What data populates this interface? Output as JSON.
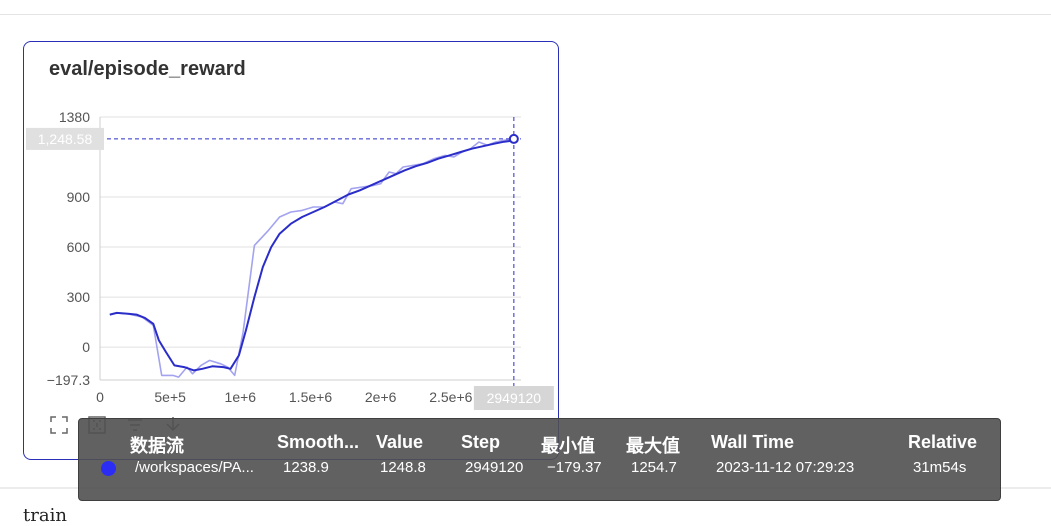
{
  "card": {
    "title": "eval/episode_reward",
    "hover_y_label": "1,248.58",
    "hover_x_label": "2949120"
  },
  "chart_data": {
    "type": "line",
    "title": "eval/episode_reward",
    "xlim": [
      0,
      3000000
    ],
    "ylim": [
      -197.3,
      1380
    ],
    "x_ticks": [
      {
        "value": 0,
        "label": "0"
      },
      {
        "value": 500000,
        "label": "5e+5"
      },
      {
        "value": 1000000,
        "label": "1e+6"
      },
      {
        "value": 1500000,
        "label": "1.5e+6"
      },
      {
        "value": 2000000,
        "label": "2e+6"
      },
      {
        "value": 2500000,
        "label": "2.5e+6"
      }
    ],
    "y_ticks": [
      {
        "value": 1380,
        "label": "1380"
      },
      {
        "value": 900,
        "label": "900"
      },
      {
        "value": 600,
        "label": "600"
      },
      {
        "value": 300,
        "label": "300"
      },
      {
        "value": 0,
        "label": "0"
      },
      {
        "value": -197.3,
        "label": "−197.3"
      }
    ],
    "grid": true,
    "series": [
      {
        "role": "raw",
        "color": "#a3a3f0",
        "points": [
          [
            70000,
            195
          ],
          [
            120000,
            205
          ],
          [
            200000,
            200
          ],
          [
            300000,
            180
          ],
          [
            380000,
            130
          ],
          [
            440000,
            -170
          ],
          [
            520000,
            -170
          ],
          [
            560000,
            -180
          ],
          [
            620000,
            -120
          ],
          [
            660000,
            -160
          ],
          [
            720000,
            -110
          ],
          [
            780000,
            -80
          ],
          [
            860000,
            -100
          ],
          [
            910000,
            -120
          ],
          [
            960000,
            -170
          ],
          [
            1020000,
            90
          ],
          [
            1100000,
            610
          ],
          [
            1200000,
            700
          ],
          [
            1280000,
            780
          ],
          [
            1360000,
            810
          ],
          [
            1440000,
            820
          ],
          [
            1520000,
            840
          ],
          [
            1600000,
            840
          ],
          [
            1670000,
            870
          ],
          [
            1730000,
            860
          ],
          [
            1790000,
            950
          ],
          [
            1870000,
            960
          ],
          [
            1950000,
            970
          ],
          [
            2000000,
            980
          ],
          [
            2060000,
            1050
          ],
          [
            2110000,
            1040
          ],
          [
            2160000,
            1080
          ],
          [
            2230000,
            1090
          ],
          [
            2300000,
            1100
          ],
          [
            2380000,
            1130
          ],
          [
            2460000,
            1150
          ],
          [
            2520000,
            1140
          ],
          [
            2580000,
            1170
          ],
          [
            2640000,
            1190
          ],
          [
            2700000,
            1230
          ],
          [
            2760000,
            1210
          ],
          [
            2820000,
            1230
          ],
          [
            2880000,
            1240
          ],
          [
            2949120,
            1248.8
          ]
        ]
      },
      {
        "role": "smoothed",
        "color": "#2b2dc9",
        "points": [
          [
            70000,
            195
          ],
          [
            120000,
            205
          ],
          [
            200000,
            200
          ],
          [
            260000,
            195
          ],
          [
            320000,
            175
          ],
          [
            380000,
            140
          ],
          [
            420000,
            40
          ],
          [
            470000,
            -30
          ],
          [
            530000,
            -110
          ],
          [
            600000,
            -120
          ],
          [
            670000,
            -140
          ],
          [
            730000,
            -130
          ],
          [
            800000,
            -115
          ],
          [
            880000,
            -120
          ],
          [
            930000,
            -130
          ],
          [
            990000,
            -50
          ],
          [
            1040000,
            100
          ],
          [
            1100000,
            300
          ],
          [
            1160000,
            480
          ],
          [
            1220000,
            600
          ],
          [
            1280000,
            680
          ],
          [
            1360000,
            740
          ],
          [
            1440000,
            780
          ],
          [
            1520000,
            810
          ],
          [
            1600000,
            840
          ],
          [
            1690000,
            880
          ],
          [
            1770000,
            915
          ],
          [
            1850000,
            940
          ],
          [
            1930000,
            970
          ],
          [
            2010000,
            1000
          ],
          [
            2090000,
            1030
          ],
          [
            2170000,
            1060
          ],
          [
            2250000,
            1085
          ],
          [
            2330000,
            1105
          ],
          [
            2410000,
            1130
          ],
          [
            2490000,
            1150
          ],
          [
            2570000,
            1170
          ],
          [
            2650000,
            1190
          ],
          [
            2730000,
            1205
          ],
          [
            2810000,
            1220
          ],
          [
            2880000,
            1232
          ],
          [
            2949120,
            1238.9
          ]
        ]
      }
    ]
  },
  "tools": {
    "icons": [
      "fullscreen-icon",
      "fit-domain-icon",
      "legend-filter-icon",
      "download-icon"
    ]
  },
  "tooltip": {
    "headers": {
      "run": "数据流",
      "smoothed": "Smooth...",
      "value": "Value",
      "step": "Step",
      "min": "最小值",
      "max": "最大值",
      "wall_time": "Wall Time",
      "relative": "Relative"
    },
    "row": {
      "run": "/workspaces/PA...",
      "smoothed": "1238.9",
      "value": "1248.8",
      "step": "2949120",
      "min": "−179.37",
      "max": "1254.7",
      "wall_time": "2023-11-12 07:29:23",
      "relative": "31m54s",
      "color": "#2b2df5"
    }
  },
  "section": {
    "title": "train"
  }
}
